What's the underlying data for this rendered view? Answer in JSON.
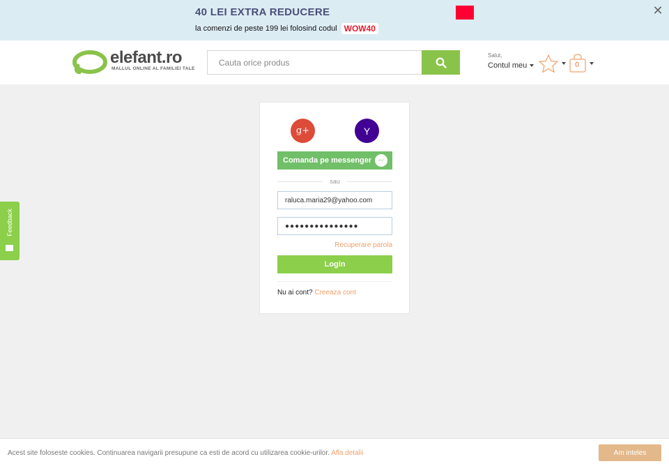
{
  "promo": {
    "title": "40 LEI EXTRA REDUCERE",
    "subtitle": "la comenzi de peste 199 lei folosind codul",
    "code": "WOW40",
    "accent_color": "#ff0033",
    "close_icon": "close-icon"
  },
  "header": {
    "logo_text": "elefant.ro",
    "logo_tagline": "MALLUL ONLINE AL FAMILIEI TALE",
    "search_placeholder": "Cauta orice produs",
    "search_icon": "search-icon",
    "account_greeting": "Salut,",
    "account_label": "Contul meu",
    "wishlist_icon": "star-icon",
    "cart_icon": "shopping-bag-icon",
    "cart_count": "0",
    "brand_color": "#8ac34a"
  },
  "login": {
    "google_label": "g+",
    "yahoo_label": "Y",
    "messenger_label": "Comanda pe messenger",
    "divider_label": "sau",
    "email_value": "raluca.maria29@yahoo.com",
    "password_value": "●●●●●●●●●●●●●●●",
    "recover_label": "Recuperare parola",
    "login_label": "Login",
    "no_account_text": "Nu ai cont?",
    "create_account_label": "Creeaza cont"
  },
  "feedback": {
    "label": "Feedback"
  },
  "cookie": {
    "text": "Acest site foloseste cookies. Continuarea navigarii presupune ca esti de acord cu utilizarea cookie-urilor.",
    "link_label": "Afla detalii",
    "accept_label": "Am inteles"
  }
}
